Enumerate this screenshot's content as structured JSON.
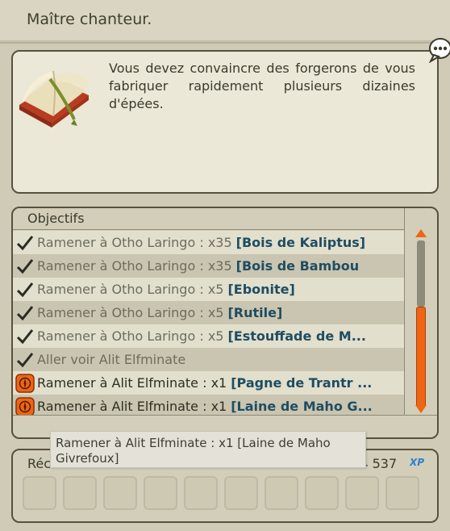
{
  "header": {
    "title": "Maître chanteur."
  },
  "quest": {
    "description": "Vous devez convaincre des forgerons de vous fabriquer rapidement plusieurs dizaines d'épées."
  },
  "objectives": {
    "label": "Objectifs",
    "items": [
      {
        "status": "done",
        "text": "Ramener à Otho Laringo : x35",
        "item": "[Bois de Kaliptus]"
      },
      {
        "status": "done",
        "text": "Ramener à Otho Laringo : x35",
        "item": "[Bois de Bambou"
      },
      {
        "status": "done",
        "text": "Ramener à Otho Laringo : x5",
        "item": "[Ebonite]"
      },
      {
        "status": "done",
        "text": "Ramener à Otho Laringo : x5",
        "item": "[Rutile]"
      },
      {
        "status": "done",
        "text": "Ramener à Otho Laringo : x5",
        "item": "[Estouffade de M..."
      },
      {
        "status": "done",
        "text": "Aller voir Alit Elfminate",
        "item": ""
      },
      {
        "status": "active",
        "text": "Ramener à Alit Elfminate : x1",
        "item": "[Pagne de Trantr ..."
      },
      {
        "status": "active",
        "text": "Ramener à Alit Elfminate : x1",
        "item": "[Laine de Maho G..."
      }
    ]
  },
  "rewards": {
    "label": "Réc",
    "xp_value": "804 537",
    "xp_badge": "XP",
    "slot_count": 10
  },
  "tooltip": {
    "text": "Ramener à Alit Elfminate : x1 [Laine de Maho Givrefoux]"
  },
  "icons": {
    "book": "quest-book-icon",
    "chat": "speech-bubble-icon",
    "done": "checkmark-icon",
    "active": "compass-icon"
  },
  "colors": {
    "accent": "#f06412",
    "item_text": "#1f4d62",
    "xp": "#2f7fcf"
  }
}
